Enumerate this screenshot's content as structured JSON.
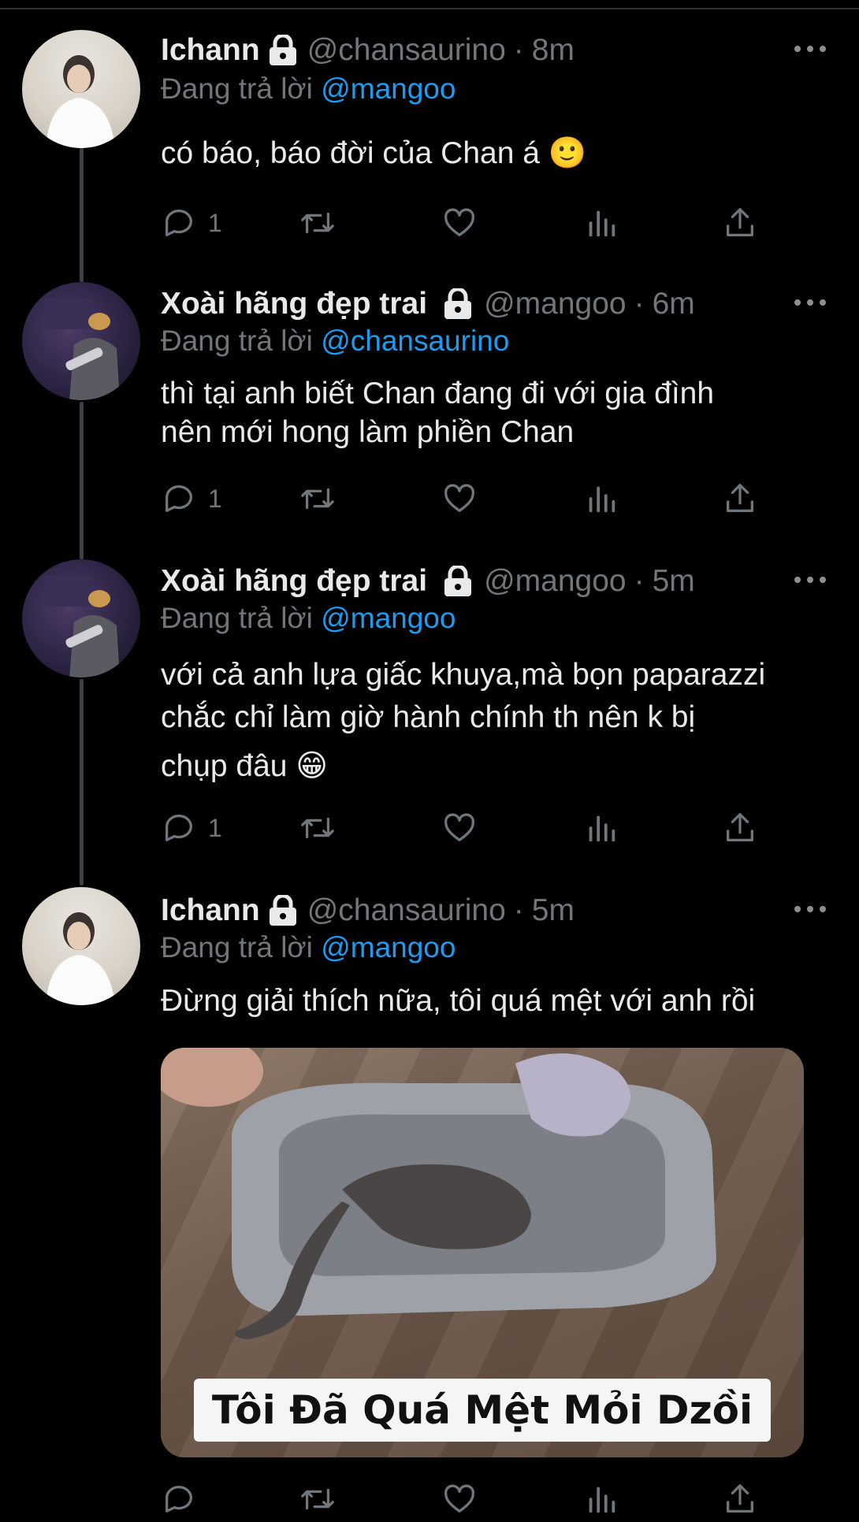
{
  "thread": [
    {
      "name": "Ichann",
      "handle": "@chansaurino",
      "separator": "·",
      "time": "8m",
      "reply_prefix": "Đang trả lời",
      "reply_to": "@mangoo",
      "text": "có báo, báo đời của Chan á 🙂",
      "reply_count": "1"
    },
    {
      "name": "Xoài hãng đẹp trai",
      "handle": "@mangoo",
      "separator": "·",
      "time": "6m",
      "reply_prefix": "Đang trả lời",
      "reply_to": "@chansaurino",
      "text_line1": "thì tại anh biết Chan đang đi với gia đình",
      "text_line2": "nên mới hong làm phiền Chan",
      "reply_count": "1"
    },
    {
      "name": "Xoài hãng đẹp trai",
      "handle": "@mangoo",
      "separator": "·",
      "time": "5m",
      "reply_prefix": "Đang trả lời",
      "reply_to": "@mangoo",
      "text_line1": "với cả anh lựa giấc khuya,mà bọn paparazzi",
      "text_line2": "chắc chỉ làm giờ hành chính th nên k bị",
      "text_line3": "chụp đâu 😁",
      "reply_count": "1"
    },
    {
      "name": "Ichann",
      "handle": "@chansaurino",
      "separator": "·",
      "time": "5m",
      "reply_prefix": "Đang trả lời",
      "reply_to": "@mangoo",
      "text": "Đừng giải thích nữa, tôi quá mệt với anh rồi",
      "media_caption": "Tôi Đã Quá Mệt Mỏi Dzồi"
    }
  ],
  "icons": [
    "lock-icon",
    "more-icon",
    "reply-icon",
    "retweet-icon",
    "like-icon",
    "views-icon",
    "share-icon"
  ],
  "colors": {
    "background": "#000000",
    "text": "#e7e9ea",
    "muted": "#71767b",
    "mention": "#1d9bf0"
  }
}
